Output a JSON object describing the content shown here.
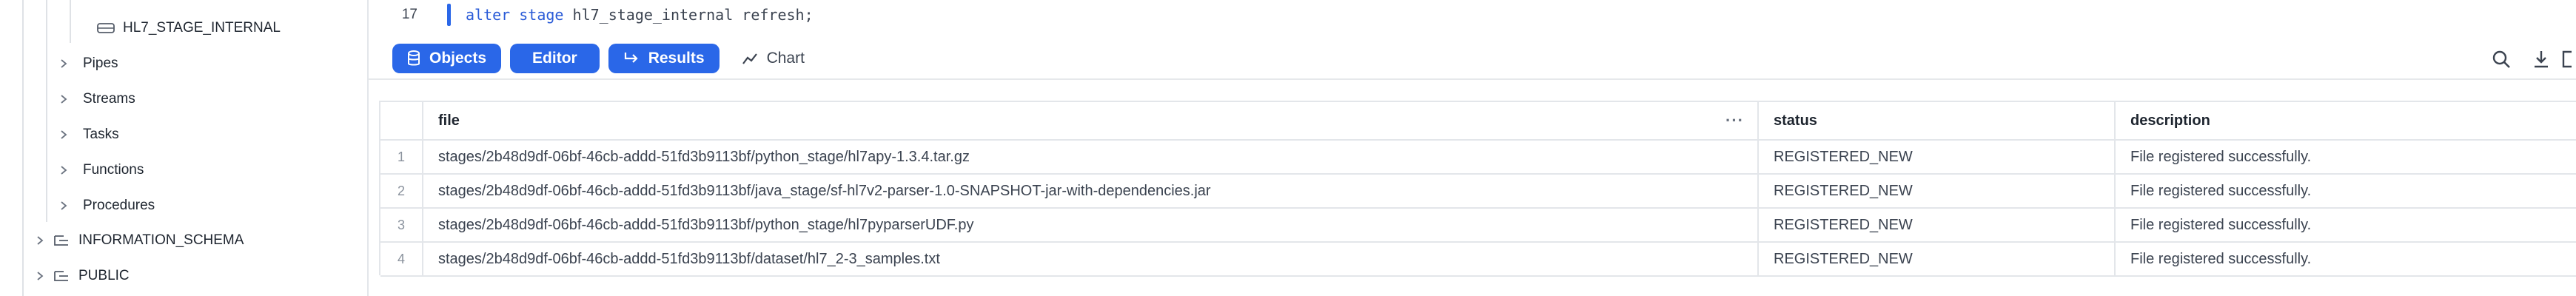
{
  "sidebar": {
    "stage_item": "HL7_STAGE_INTERNAL",
    "items": [
      {
        "label": "Pipes"
      },
      {
        "label": "Streams"
      },
      {
        "label": "Tasks"
      },
      {
        "label": "Functions"
      },
      {
        "label": "Procedures"
      }
    ],
    "schemas": [
      {
        "label": "INFORMATION_SCHEMA"
      },
      {
        "label": "PUBLIC"
      }
    ]
  },
  "editor": {
    "line_number": "17",
    "keyword1": "alter",
    "keyword2": "stage",
    "rest": " hl7_stage_internal refresh;"
  },
  "toolbar": {
    "objects_label": "Objects",
    "editor_label": "Editor",
    "results_label": "Results",
    "chart_label": "Chart"
  },
  "results": {
    "columns": [
      "file",
      "status",
      "description"
    ],
    "rows": [
      {
        "idx": "1",
        "file": "stages/2b48d9df-06bf-46cb-addd-51fd3b9113bf/python_stage/hl7apy-1.3.4.tar.gz",
        "status": "REGISTERED_NEW",
        "description": "File registered successfully."
      },
      {
        "idx": "2",
        "file": "stages/2b48d9df-06bf-46cb-addd-51fd3b9113bf/java_stage/sf-hl7v2-parser-1.0-SNAPSHOT-jar-with-dependencies.jar",
        "status": "REGISTERED_NEW",
        "description": "File registered successfully."
      },
      {
        "idx": "3",
        "file": "stages/2b48d9df-06bf-46cb-addd-51fd3b9113bf/python_stage/hl7pyparserUDF.py",
        "status": "REGISTERED_NEW",
        "description": "File registered successfully."
      },
      {
        "idx": "4",
        "file": "stages/2b48d9df-06bf-46cb-addd-51fd3b9113bf/dataset/hl7_2-3_samples.txt",
        "status": "REGISTERED_NEW",
        "description": "File registered successfully."
      }
    ]
  },
  "colors": {
    "accent": "#2a67e8",
    "border": "#e3e6ea",
    "text": "#1e252f"
  }
}
